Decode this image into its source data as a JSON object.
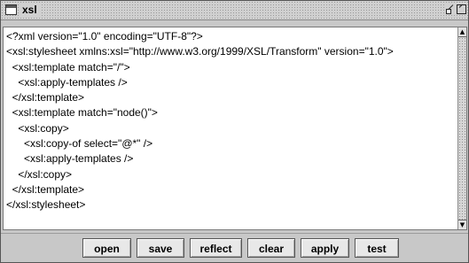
{
  "window": {
    "title": "xsl",
    "icon": "window-icon",
    "controls": [
      "minimize-icon",
      "maximize-icon"
    ]
  },
  "editor": {
    "content": "<?xml version=\"1.0\" encoding=\"UTF-8\"?>\n<xsl:stylesheet xmlns:xsl=\"http://www.w3.org/1999/XSL/Transform\" version=\"1.0\">\n  <xsl:template match=\"/\">\n    <xsl:apply-templates />\n  </xsl:template>\n  <xsl:template match=\"node()\">\n    <xsl:copy>\n      <xsl:copy-of select=\"@*\" />\n      <xsl:apply-templates />\n    </xsl:copy>\n  </xsl:template>\n</xsl:stylesheet>"
  },
  "buttons": {
    "open": "open",
    "save": "save",
    "reflect": "reflect",
    "clear": "clear",
    "apply": "apply",
    "test": "test"
  },
  "scrollbar": {
    "up_icon": "arrow-up-icon",
    "down_icon": "arrow-down-icon"
  }
}
